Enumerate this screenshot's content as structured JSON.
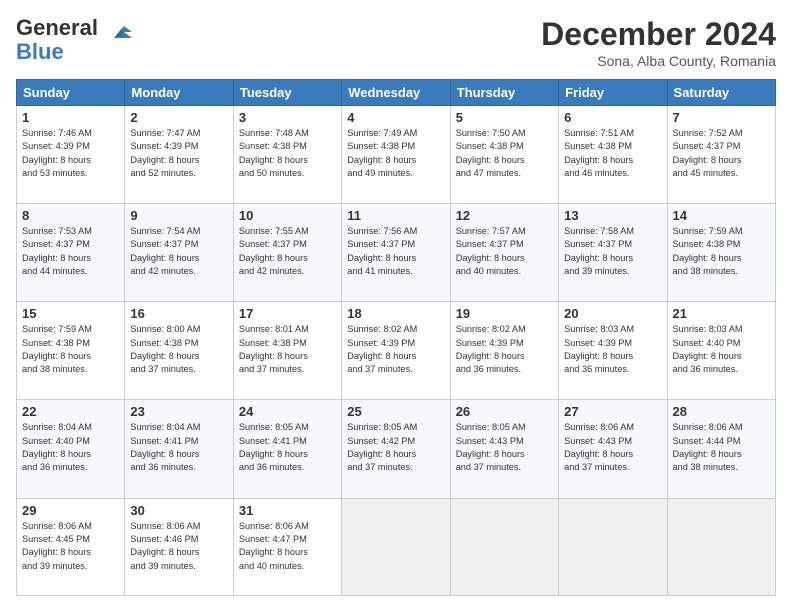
{
  "header": {
    "logo_general": "General",
    "logo_blue": "Blue",
    "month_title": "December 2024",
    "subtitle": "Sona, Alba County, Romania"
  },
  "weekdays": [
    "Sunday",
    "Monday",
    "Tuesday",
    "Wednesday",
    "Thursday",
    "Friday",
    "Saturday"
  ],
  "weeks": [
    [
      {
        "day": "1",
        "info": "Sunrise: 7:46 AM\nSunset: 4:39 PM\nDaylight: 8 hours\nand 53 minutes."
      },
      {
        "day": "2",
        "info": "Sunrise: 7:47 AM\nSunset: 4:39 PM\nDaylight: 8 hours\nand 52 minutes."
      },
      {
        "day": "3",
        "info": "Sunrise: 7:48 AM\nSunset: 4:38 PM\nDaylight: 8 hours\nand 50 minutes."
      },
      {
        "day": "4",
        "info": "Sunrise: 7:49 AM\nSunset: 4:38 PM\nDaylight: 8 hours\nand 49 minutes."
      },
      {
        "day": "5",
        "info": "Sunrise: 7:50 AM\nSunset: 4:38 PM\nDaylight: 8 hours\nand 47 minutes."
      },
      {
        "day": "6",
        "info": "Sunrise: 7:51 AM\nSunset: 4:38 PM\nDaylight: 8 hours\nand 46 minutes."
      },
      {
        "day": "7",
        "info": "Sunrise: 7:52 AM\nSunset: 4:37 PM\nDaylight: 8 hours\nand 45 minutes."
      }
    ],
    [
      {
        "day": "8",
        "info": "Sunrise: 7:53 AM\nSunset: 4:37 PM\nDaylight: 8 hours\nand 44 minutes."
      },
      {
        "day": "9",
        "info": "Sunrise: 7:54 AM\nSunset: 4:37 PM\nDaylight: 8 hours\nand 42 minutes."
      },
      {
        "day": "10",
        "info": "Sunrise: 7:55 AM\nSunset: 4:37 PM\nDaylight: 8 hours\nand 42 minutes."
      },
      {
        "day": "11",
        "info": "Sunrise: 7:56 AM\nSunset: 4:37 PM\nDaylight: 8 hours\nand 41 minutes."
      },
      {
        "day": "12",
        "info": "Sunrise: 7:57 AM\nSunset: 4:37 PM\nDaylight: 8 hours\nand 40 minutes."
      },
      {
        "day": "13",
        "info": "Sunrise: 7:58 AM\nSunset: 4:37 PM\nDaylight: 8 hours\nand 39 minutes."
      },
      {
        "day": "14",
        "info": "Sunrise: 7:59 AM\nSunset: 4:38 PM\nDaylight: 8 hours\nand 38 minutes."
      }
    ],
    [
      {
        "day": "15",
        "info": "Sunrise: 7:59 AM\nSunset: 4:38 PM\nDaylight: 8 hours\nand 38 minutes."
      },
      {
        "day": "16",
        "info": "Sunrise: 8:00 AM\nSunset: 4:38 PM\nDaylight: 8 hours\nand 37 minutes."
      },
      {
        "day": "17",
        "info": "Sunrise: 8:01 AM\nSunset: 4:38 PM\nDaylight: 8 hours\nand 37 minutes."
      },
      {
        "day": "18",
        "info": "Sunrise: 8:02 AM\nSunset: 4:39 PM\nDaylight: 8 hours\nand 37 minutes."
      },
      {
        "day": "19",
        "info": "Sunrise: 8:02 AM\nSunset: 4:39 PM\nDaylight: 8 hours\nand 36 minutes."
      },
      {
        "day": "20",
        "info": "Sunrise: 8:03 AM\nSunset: 4:39 PM\nDaylight: 8 hours\nand 36 minutes."
      },
      {
        "day": "21",
        "info": "Sunrise: 8:03 AM\nSunset: 4:40 PM\nDaylight: 8 hours\nand 36 minutes."
      }
    ],
    [
      {
        "day": "22",
        "info": "Sunrise: 8:04 AM\nSunset: 4:40 PM\nDaylight: 8 hours\nand 36 minutes."
      },
      {
        "day": "23",
        "info": "Sunrise: 8:04 AM\nSunset: 4:41 PM\nDaylight: 8 hours\nand 36 minutes."
      },
      {
        "day": "24",
        "info": "Sunrise: 8:05 AM\nSunset: 4:41 PM\nDaylight: 8 hours\nand 36 minutes."
      },
      {
        "day": "25",
        "info": "Sunrise: 8:05 AM\nSunset: 4:42 PM\nDaylight: 8 hours\nand 37 minutes."
      },
      {
        "day": "26",
        "info": "Sunrise: 8:05 AM\nSunset: 4:43 PM\nDaylight: 8 hours\nand 37 minutes."
      },
      {
        "day": "27",
        "info": "Sunrise: 8:06 AM\nSunset: 4:43 PM\nDaylight: 8 hours\nand 37 minutes."
      },
      {
        "day": "28",
        "info": "Sunrise: 8:06 AM\nSunset: 4:44 PM\nDaylight: 8 hours\nand 38 minutes."
      }
    ],
    [
      {
        "day": "29",
        "info": "Sunrise: 8:06 AM\nSunset: 4:45 PM\nDaylight: 8 hours\nand 39 minutes."
      },
      {
        "day": "30",
        "info": "Sunrise: 8:06 AM\nSunset: 4:46 PM\nDaylight: 8 hours\nand 39 minutes."
      },
      {
        "day": "31",
        "info": "Sunrise: 8:06 AM\nSunset: 4:47 PM\nDaylight: 8 hours\nand 40 minutes."
      },
      {
        "day": "",
        "info": ""
      },
      {
        "day": "",
        "info": ""
      },
      {
        "day": "",
        "info": ""
      },
      {
        "day": "",
        "info": ""
      }
    ]
  ]
}
